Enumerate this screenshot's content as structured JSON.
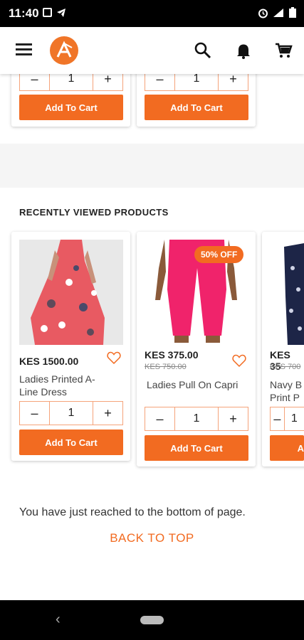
{
  "status_bar": {
    "time": "11:40"
  },
  "top_cards": {
    "qty_minus": "–",
    "qty_plus": "+",
    "items": [
      {
        "qty": "1",
        "cart_label": "Add To Cart"
      },
      {
        "qty": "1",
        "cart_label": "Add To Cart"
      }
    ]
  },
  "recent": {
    "title": "RECENTLY VIEWED PRODUCTS",
    "products": [
      {
        "price": "KES 1500.00",
        "old_price": "",
        "name": "Ladies Printed A-Line Dress",
        "qty": "1",
        "cart_label": "Add To Cart",
        "badge": ""
      },
      {
        "price": "KES 375.00",
        "old_price": "KES 750.00",
        "name": "Ladies Pull On Capri",
        "qty": "1",
        "cart_label": "Add To Cart",
        "badge": "50% OFF"
      },
      {
        "price": "KES 35",
        "old_price": "KES 700",
        "name": "Navy B Print P",
        "qty": "1",
        "cart_label": "A",
        "badge": ""
      }
    ]
  },
  "footer": {
    "end_text": "You have just reached to the bottom of page.",
    "back_to_top": "BACK TO TOP"
  },
  "colors": {
    "accent": "#f26b21"
  }
}
